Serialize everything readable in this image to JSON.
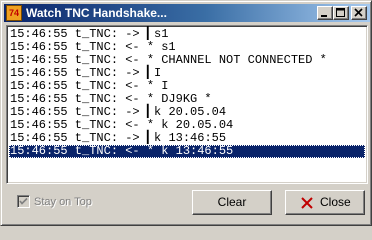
{
  "window": {
    "title": "Watch TNC Handshake...",
    "app_icon_text": "74"
  },
  "log": {
    "lines": [
      "15:46:55 t_TNC: -> ▎s1",
      "15:46:55 t_TNC: <- * s1",
      "15:46:55 t_TNC: <- * CHANNEL NOT CONNECTED *",
      "15:46:55 t_TNC: -> ▎I",
      "15:46:55 t_TNC: <- * I",
      "15:46:55 t_TNC: <- * DJ9KG *",
      "15:46:55 t_TNC: -> ▎k 20.05.04",
      "15:46:55 t_TNC: <- * k 20.05.04",
      "15:46:55 t_TNC: -> ▎k 13:46:55",
      "15:46:55 t_TNC: <- * k 13:46:55"
    ],
    "selected_index": 9
  },
  "options": {
    "stay_on_top_label": "Stay on Top",
    "stay_on_top_checked": true
  },
  "buttons": {
    "clear_label": "Clear",
    "close_label": "Close"
  },
  "colors": {
    "selection": "#0a246a",
    "close_icon": "#c00000"
  }
}
